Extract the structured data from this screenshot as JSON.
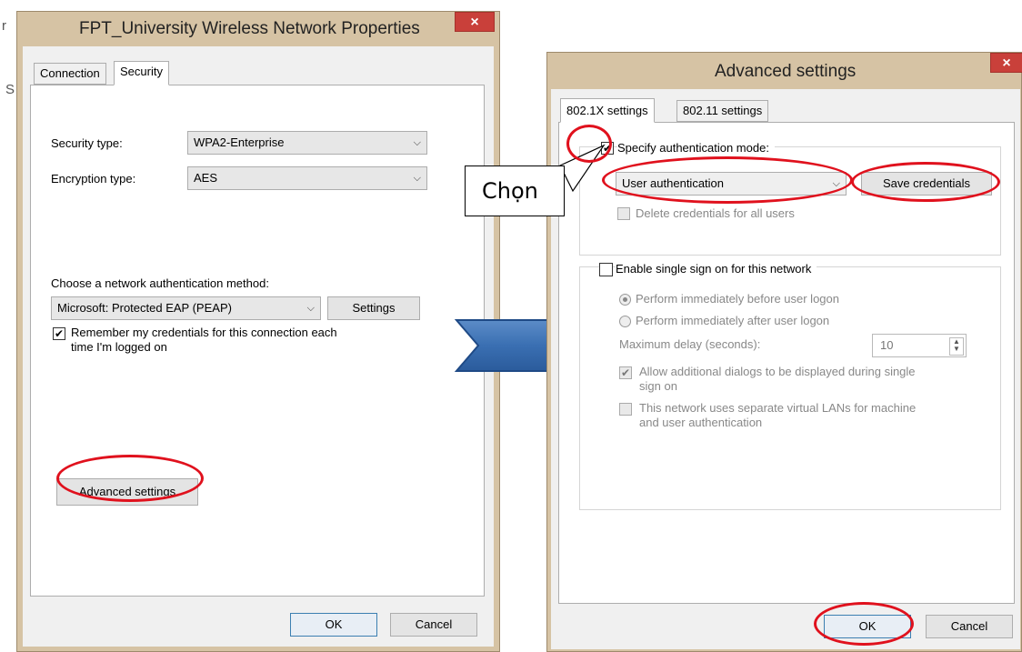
{
  "left_dialog": {
    "title": "FPT_University Wireless Network Properties",
    "close_glyph": "×",
    "tabs": [
      {
        "label": "Connection",
        "active": false
      },
      {
        "label": "Security",
        "active": true
      }
    ],
    "security_type_label": "Security type:",
    "security_type_value": "WPA2-Enterprise",
    "encryption_type_label": "Encryption type:",
    "encryption_type_value": "AES",
    "auth_method_label": "Choose a network authentication method:",
    "auth_method_value": "Microsoft: Protected EAP (PEAP)",
    "settings_button": "Settings",
    "remember_checked": true,
    "remember_label_line1": "Remember my credentials for this connection each",
    "remember_label_line2": "time I'm logged on",
    "advanced_button": "Advanced settings",
    "ok_button": "OK",
    "cancel_button": "Cancel"
  },
  "right_dialog": {
    "title": "Advanced settings",
    "close_glyph": "×",
    "tabs": [
      {
        "label": "802.1X settings",
        "active": true
      },
      {
        "label": "802.11 settings",
        "active": false
      }
    ],
    "specify_auth_checked": true,
    "specify_auth_label": "Specify authentication mode:",
    "auth_mode_value": "User authentication",
    "save_credentials_button": "Save credentials",
    "delete_credentials_label": "Delete credentials for all users",
    "sso_checked": false,
    "sso_label": "Enable single sign on for this network",
    "perform_before_label": "Perform immediately before user logon",
    "perform_after_label": "Perform immediately after user logon",
    "max_delay_label": "Maximum delay (seconds):",
    "max_delay_value": "10",
    "allow_dialogs_checked": true,
    "allow_dialogs_line1": "Allow additional dialogs to be displayed during single",
    "allow_dialogs_line2": "sign on",
    "separate_vlans_line1": "This network uses separate virtual LANs for machine",
    "separate_vlans_line2": "and user authentication",
    "ok_button": "OK",
    "cancel_button": "Cancel"
  },
  "annotation": {
    "callout_text": "Chọn",
    "highlight_color": "#e0111d",
    "arrow_color": "#4f81bd"
  },
  "background_fragments": [
    "r",
    "S"
  ]
}
